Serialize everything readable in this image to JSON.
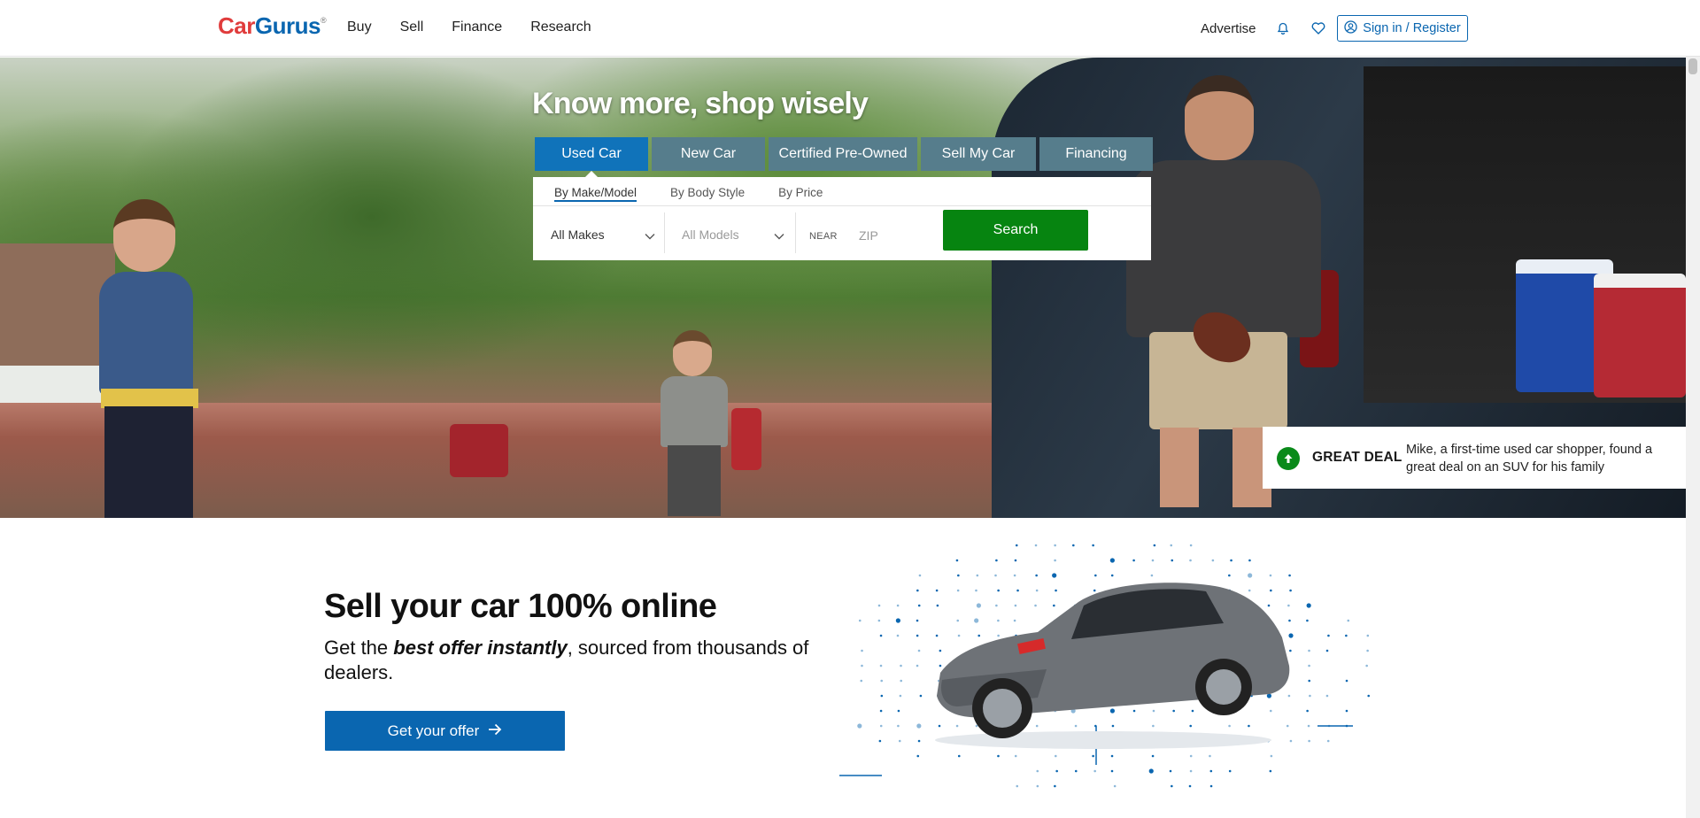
{
  "header": {
    "logo": {
      "part1": "Car",
      "part2": "Gurus",
      "mark": "®"
    },
    "nav": [
      "Buy",
      "Sell",
      "Finance",
      "Research"
    ],
    "advertise": "Advertise",
    "icons": [
      "bell-icon",
      "heart-icon"
    ],
    "signin": "Sign in / Register"
  },
  "hero": {
    "title": "Know more, shop wisely",
    "tabs": [
      "Used Car",
      "New Car",
      "Certified Pre-Owned",
      "Sell My Car",
      "Financing"
    ],
    "active_tab": "Used Car",
    "subtabs": [
      "By Make/Model",
      "By Body Style",
      "By Price"
    ],
    "makes_value": "All Makes",
    "models_value": "All Models",
    "near_label": "NEAR",
    "zip_placeholder": "ZIP",
    "search_label": "Search",
    "deal": {
      "label": "GREAT DEAL",
      "text": "Mike, a first-time used car shopper, found a great deal on an SUV for his family"
    }
  },
  "sell": {
    "title": "Sell your car 100% online",
    "sub_pre": "Get the ",
    "sub_em": "best offer instantly",
    "sub_post": ", sourced from thousands of dealers.",
    "button": "Get your offer"
  },
  "colors": {
    "brand_blue": "#0a66b0",
    "logo_red": "#e03c3c",
    "tab_active": "#1073ba",
    "tab_inactive": "#567d8c",
    "search_green": "#068410",
    "deal_green": "#0a8a1a"
  }
}
